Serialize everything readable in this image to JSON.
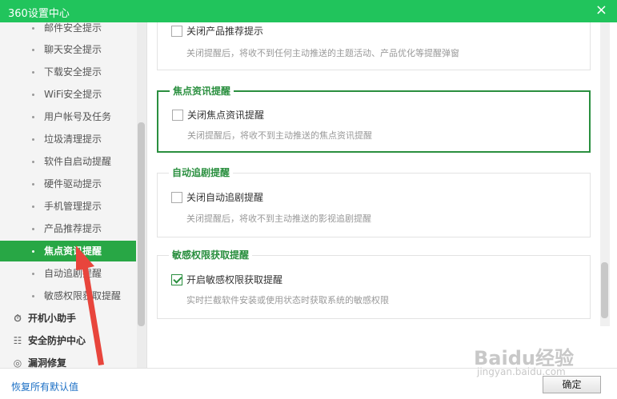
{
  "window": {
    "title": "360设置中心",
    "close_glyph": "×"
  },
  "sidebar": {
    "items": [
      {
        "label": "邮件安全提示",
        "active": false
      },
      {
        "label": "聊天安全提示",
        "active": false
      },
      {
        "label": "下载安全提示",
        "active": false
      },
      {
        "label": "WiFi安全提示",
        "active": false
      },
      {
        "label": "用户帐号及任务",
        "active": false
      },
      {
        "label": "垃圾清理提示",
        "active": false
      },
      {
        "label": "软件自启动提醒",
        "active": false
      },
      {
        "label": "硬件驱动提示",
        "active": false
      },
      {
        "label": "手机管理提示",
        "active": false
      },
      {
        "label": "产品推荐提示",
        "active": false
      },
      {
        "label": "焦点资讯提醒",
        "active": true
      },
      {
        "label": "自动追剧提醒",
        "active": false
      },
      {
        "label": "敏感权限获取提醒",
        "active": false
      }
    ],
    "groups": [
      {
        "label": "开机小助手",
        "icon": "timer-icon"
      },
      {
        "label": "安全防护中心",
        "icon": "shield-list-icon"
      },
      {
        "label": "漏洞修复",
        "icon": "patch-icon"
      }
    ]
  },
  "main": {
    "sections": [
      {
        "legend": "",
        "option": "关闭产品推荐提示",
        "checked": false,
        "desc": "关闭提醒后，将收不到任何主动推送的主题活动、产品优化等提醒弹窗"
      },
      {
        "legend": "焦点资讯提醒",
        "option": "关闭焦点资讯提醒",
        "checked": false,
        "desc": "关闭提醒后，将收不到主动推送的焦点资讯提醒"
      },
      {
        "legend": "自动追剧提醒",
        "option": "关闭自动追剧提醒",
        "checked": false,
        "desc": "关闭提醒后，将收不到主动推送的影视追剧提醒"
      },
      {
        "legend": "敏感权限获取提醒",
        "option": "开启敏感权限获取提醒",
        "checked": true,
        "desc": "实时拦截软件安装或使用状态时获取系统的敏感权限"
      }
    ]
  },
  "footer": {
    "restore_label": "恢复所有默认值",
    "ok_label": "确定"
  },
  "watermark": {
    "text": "Baidu经验",
    "sub": "jingyan.baidu.com"
  },
  "colors": {
    "titlebar": "#21c45c",
    "active_item": "#28a745",
    "accent": "#2a8f3f",
    "arrow": "#e8453c"
  }
}
